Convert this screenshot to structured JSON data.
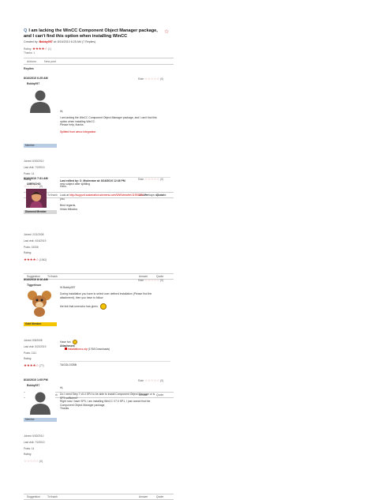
{
  "question": {
    "title": "I am lacking the WinCC Component Object Manager package, and I can't find this option when installing WinCC",
    "created_prefix": "Created by:",
    "author": "Bobby097",
    "created_suffix": "at: 8/16/2010 6:25 AM (7 Replies)",
    "rating_label": "Rating:",
    "rating_stars": "★★★★☆",
    "rating_count": "(1)",
    "thanks_label": "Thanks: 1"
  },
  "actions": {
    "left": "Actions",
    "right": "New post"
  },
  "replies_heading": "Replies",
  "posts": [
    {
      "date": "8/16/2010 6:25 AM",
      "rate_label": "Rate",
      "rate_stars": "☆☆☆☆☆",
      "rate_count": "(0)",
      "username": "Bobby097",
      "badge": "Member",
      "joined": "Joined: 6/30/2010",
      "last_visit": "Last visit: 7/2/2010",
      "posts": "Posts: 14",
      "rating_label": "Rating:",
      "rating_stars": "☆☆☆☆☆",
      "rating_count": "(0)",
      "lines": [
        "Hi,",
        "",
        "I am lacking the WinCC Component Object Manager package, and I can't find this",
        "option when installing WinCC.",
        "Please help, thanks."
      ],
      "link": "Splitted from wincc integration.",
      "edit_line": "Last edited by: O_Moderator at: 8/16/2010 12:36 PM",
      "edit_note": "new subject after splitting",
      "bar_left": "Suggestion",
      "bar_thank": "To thank",
      "bar_answer": "Answer",
      "bar_quote": "Quote"
    },
    {
      "date": "8/16/2010 7:31 AM",
      "rate_label": "Rate",
      "rate_stars": "☆☆☆☆☆",
      "rate_count": "(0)",
      "username": "UMENCHO",
      "badge": "Diamond Member",
      "joined": "Joined: 2/21/2008",
      "last_visit": "Last visit: 4/16/2019",
      "posts": "Posts: 15336",
      "rating_label": "Rating:",
      "rating_stars": "★★★★☆",
      "rating_count": "(1942)",
      "hello": "Hello,",
      "look_prefix": "Look at",
      "look_link": "http://support.automation.siemens.com/WW/view/en/11991594",
      "look_suffix": "Perhaps will make you.",
      "regards": "Best regards,",
      "signoff": "Hristo Mihailov",
      "bar_left": "Suggestion",
      "bar_thank": "To thank",
      "bar_answer": "Answer",
      "bar_quote": "Quote"
    },
    {
      "date": "8/16/2010 8:16 AM",
      "rate_label": "Rate",
      "rate_stars": "☆☆☆☆☆",
      "rate_count": "(0)",
      "username": "Tiggerleum",
      "badge": "Gold Member",
      "joined": "Joined: 8/8/2008",
      "last_visit": "Last visit: 5/22/2019",
      "posts": "Posts: 1111",
      "rating_label": "Rating:",
      "rating_stars": "★★★★☆",
      "rating_count": "(77)",
      "greeting": "Hi Bobby097",
      "install_line1": "During installation you have to select user defined installation (Please find the",
      "install_line2": "attachment), then you have to follow",
      "umencho_line": "the link that umencho has given.",
      "have_fun": "Have fun",
      "attachment_label": "Attachment",
      "attachment_name": "installationcc.zip",
      "attachment_downloads": "(1768 Downloads)",
      "tag": "TAGGLOOBB",
      "bar_left": "Suggestion",
      "bar_thank": "To thank",
      "bar_answer": "Answer",
      "bar_quote": "Quote"
    },
    {
      "date": "8/16/2010 1:05 PM",
      "rate_label": "Rate",
      "rate_stars": "☆☆☆☆☆",
      "rate_count": "(0)",
      "username": "Bobby097",
      "badge": "Member",
      "joined": "Joined: 6/30/2010",
      "last_visit": "Last visit: 7/2/2010",
      "posts": "Posts: 14",
      "rating_label": "Rating:",
      "rating_stars": "☆☆☆☆☆",
      "rating_count": "(0)",
      "lines": [
        "Hi,",
        "",
        "Do I need Step 7 v5.4 SP4 to be able to install Component Object Manager or is",
        "SP3 sufficient?",
        "Right now I have SP3, I am installing WinCC V7.0 SP1, I just cannot find the",
        "Component Object Manager package.",
        "Thanks."
      ],
      "bar_left": "Suggestion",
      "bar_thank": "To thank",
      "bar_answer": "Answer",
      "bar_quote": "Quote"
    }
  ]
}
